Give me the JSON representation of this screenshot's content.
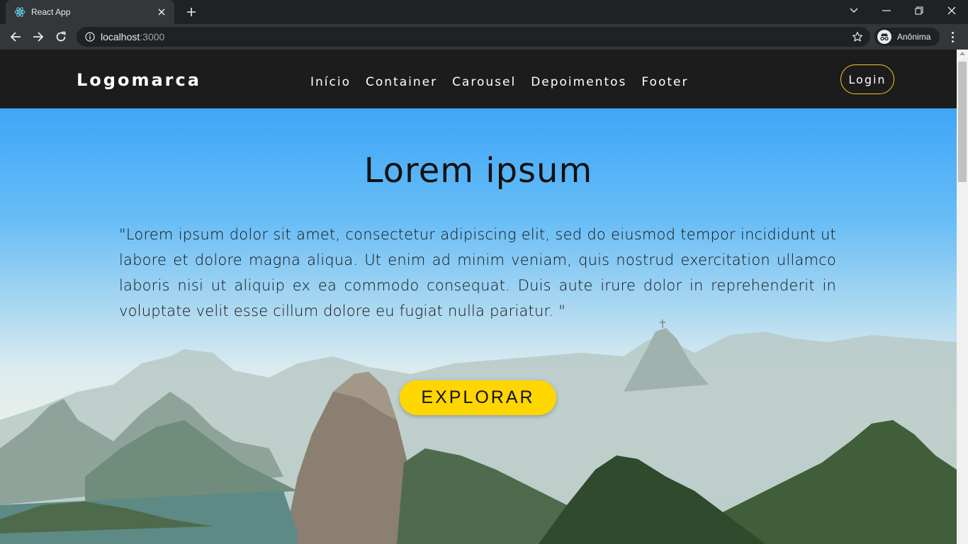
{
  "browser": {
    "tab_title": "React App",
    "url_host": "localhost",
    "url_port": ":3000",
    "profile_label": "Anônima"
  },
  "site": {
    "logo": "Logomarca",
    "nav": [
      "Início",
      "Container",
      "Carousel",
      "Depoimentos",
      "Footer"
    ],
    "login_label": "Login"
  },
  "hero": {
    "title": "Lorem ipsum",
    "text": "\"Lorem ipsum dolor sit amet, consectetur adipiscing elit, sed do eiusmod tempor incididunt ut labore et dolore magna aliqua. Ut enim ad minim veniam, quis nostrud exercitation ullamco laboris nisi ut aliquip ex ea commodo consequat. Duis aute irure dolor in reprehenderit in voluptate velit esse cillum dolore eu fugiat nulla pariatur. \"",
    "cta_label": "EXPLORAR"
  },
  "colors": {
    "accent": "#ffd600",
    "navbar_bg": "#1c1c1c",
    "login_border": "#f5c518"
  },
  "icons": {
    "tab_favicon": "react-icon",
    "reload": "reload-icon",
    "back": "back-arrow-icon",
    "forward": "forward-arrow-icon",
    "star": "star-icon",
    "incognito": "incognito-icon"
  }
}
